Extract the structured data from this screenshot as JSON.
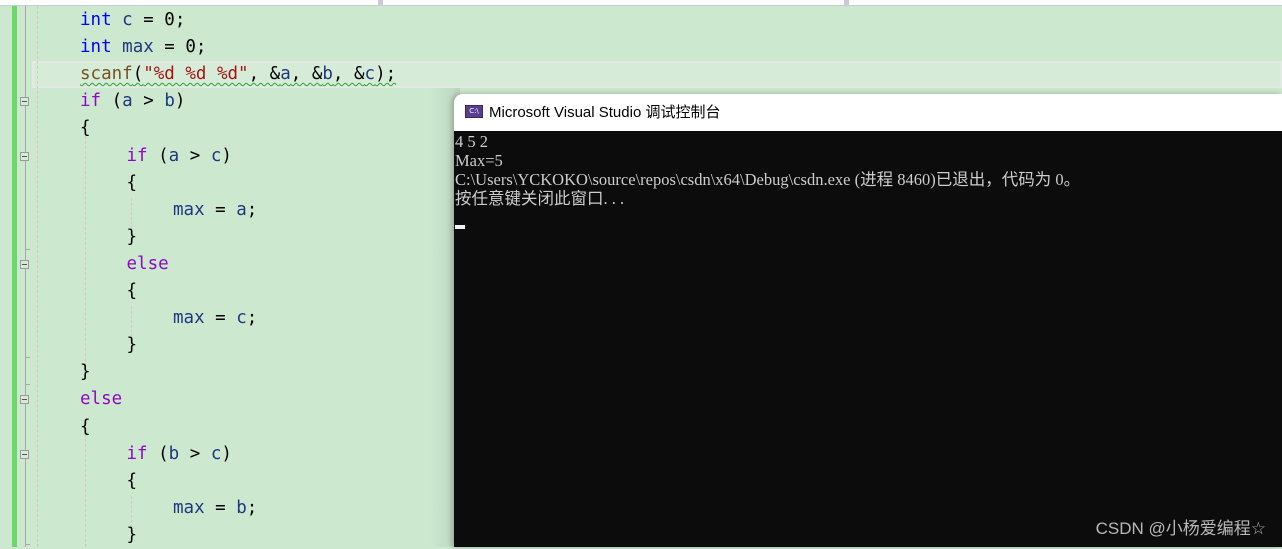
{
  "editor": {
    "lines": [
      {
        "indent": 0,
        "tokens": [
          {
            "t": "int",
            "c": "kw"
          },
          {
            "t": " "
          },
          {
            "t": "c",
            "c": "id"
          },
          {
            "t": " = 0;"
          }
        ]
      },
      {
        "indent": 0,
        "tokens": [
          {
            "t": "int",
            "c": "kw"
          },
          {
            "t": " "
          },
          {
            "t": "max",
            "c": "id"
          },
          {
            "t": " = 0;"
          }
        ]
      },
      {
        "indent": 0,
        "current": true,
        "tokens": [
          {
            "t": "scanf",
            "c": "fn"
          },
          {
            "t": "("
          },
          {
            "t": "\"%d %d %d\"",
            "c": "str"
          },
          {
            "t": ", &"
          },
          {
            "t": "a",
            "c": "id"
          },
          {
            "t": ", &"
          },
          {
            "t": "b",
            "c": "id"
          },
          {
            "t": ", &"
          },
          {
            "t": "c",
            "c": "id"
          },
          {
            "t": ");"
          }
        ]
      },
      {
        "indent": 0,
        "fold": true,
        "tokens": [
          {
            "t": "if",
            "c": "kw2"
          },
          {
            "t": " ("
          },
          {
            "t": "a",
            "c": "id"
          },
          {
            "t": " > "
          },
          {
            "t": "b",
            "c": "id"
          },
          {
            "t": ")"
          }
        ]
      },
      {
        "indent": 0,
        "tokens": [
          {
            "t": "{"
          }
        ]
      },
      {
        "indent": 1,
        "fold": true,
        "tokens": [
          {
            "t": "if",
            "c": "kw2"
          },
          {
            "t": " ("
          },
          {
            "t": "a",
            "c": "id"
          },
          {
            "t": " > "
          },
          {
            "t": "c",
            "c": "id"
          },
          {
            "t": ")"
          }
        ]
      },
      {
        "indent": 1,
        "tokens": [
          {
            "t": "{"
          }
        ]
      },
      {
        "indent": 2,
        "tokens": [
          {
            "t": "max",
            "c": "id"
          },
          {
            "t": " = "
          },
          {
            "t": "a",
            "c": "id"
          },
          {
            "t": ";"
          }
        ]
      },
      {
        "indent": 1,
        "tokens": [
          {
            "t": "}"
          }
        ]
      },
      {
        "indent": 1,
        "fold": true,
        "tokens": [
          {
            "t": "else",
            "c": "kw2"
          }
        ]
      },
      {
        "indent": 1,
        "tokens": [
          {
            "t": "{"
          }
        ]
      },
      {
        "indent": 2,
        "tokens": [
          {
            "t": "max",
            "c": "id"
          },
          {
            "t": " = "
          },
          {
            "t": "c",
            "c": "id"
          },
          {
            "t": ";"
          }
        ]
      },
      {
        "indent": 1,
        "tokens": [
          {
            "t": "}"
          }
        ]
      },
      {
        "indent": 0,
        "tokens": [
          {
            "t": "}"
          }
        ]
      },
      {
        "indent": 0,
        "fold": true,
        "tokens": [
          {
            "t": "else",
            "c": "kw2"
          }
        ]
      },
      {
        "indent": 0,
        "tokens": [
          {
            "t": "{"
          }
        ]
      },
      {
        "indent": 1,
        "fold": true,
        "tokens": [
          {
            "t": "if",
            "c": "kw2"
          },
          {
            "t": " ("
          },
          {
            "t": "b",
            "c": "id"
          },
          {
            "t": " > "
          },
          {
            "t": "c",
            "c": "id"
          },
          {
            "t": ")"
          }
        ]
      },
      {
        "indent": 1,
        "tokens": [
          {
            "t": "{"
          }
        ]
      },
      {
        "indent": 2,
        "tokens": [
          {
            "t": "max",
            "c": "id"
          },
          {
            "t": " = "
          },
          {
            "t": "b",
            "c": "id"
          },
          {
            "t": ";"
          }
        ]
      },
      {
        "indent": 1,
        "tokens": [
          {
            "t": "}"
          }
        ]
      }
    ]
  },
  "console": {
    "app_icon": "console-app-icon",
    "app_icon_text": "C:\\",
    "title": "Microsoft Visual Studio 调试控制台",
    "output_lines": [
      "4 5 2",
      "Max=5",
      "C:\\Users\\YCKOKO\\source\\repos\\csdn\\x64\\Debug\\csdn.exe (进程 8460)已退出，代码为 0。",
      "按任意键关闭此窗口. . ."
    ]
  },
  "watermark": "CSDN @小杨爱编程☆",
  "colors": {
    "editor_bg": "#cce8cf",
    "change_bar": "#6ad96a",
    "keyword": "#0000ff",
    "control_keyword": "#8f08c4",
    "identifier": "#1f377f",
    "function": "#74531f",
    "string": "#a31515",
    "console_bg": "#0c0c0c",
    "console_text": "#cccccc"
  }
}
